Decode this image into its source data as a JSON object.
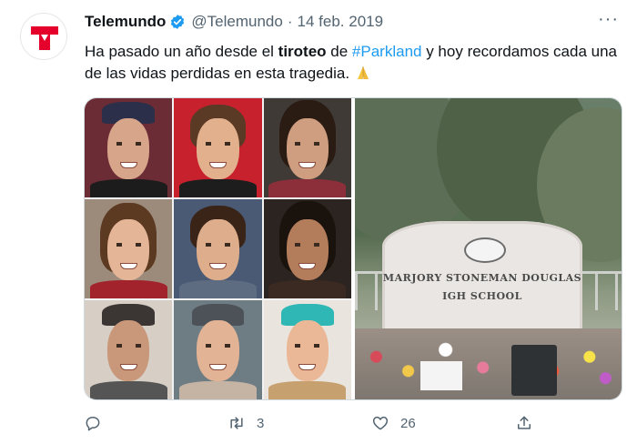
{
  "author": {
    "display_name": "Telemundo",
    "handle": "@Telemundo",
    "separator": "·",
    "date": "14 feb. 2019",
    "verified": true,
    "avatar_icon": "telemundo-logo-icon",
    "brand_color": "#e4002b"
  },
  "menu": {
    "more_label": "···"
  },
  "text": {
    "part1": "Ha pasado un año desde el ",
    "bold": "tiroteo",
    "part2": " de ",
    "hashtag": "#Parkland",
    "part3": " y hoy recordamos cada una de las vidas perdidas en esta tragedia. ",
    "emoji_icon": "folded-hands-icon"
  },
  "media": {
    "left": "collage-of-victims-photos",
    "right": "school-sign-memorial-photo",
    "sign_line1": "MARJORY STONEMAN DOUGLAS",
    "sign_line2": "IGH SCHOOL"
  },
  "actions": {
    "reply": {
      "icon": "reply-icon",
      "count": ""
    },
    "retweet": {
      "icon": "retweet-icon",
      "count": "3"
    },
    "like": {
      "icon": "heart-icon",
      "count": "26"
    },
    "share": {
      "icon": "share-icon",
      "count": ""
    }
  },
  "colors": {
    "link": "#1d9bf0",
    "secondary_text": "#536471",
    "primary_text": "#0f1419"
  }
}
